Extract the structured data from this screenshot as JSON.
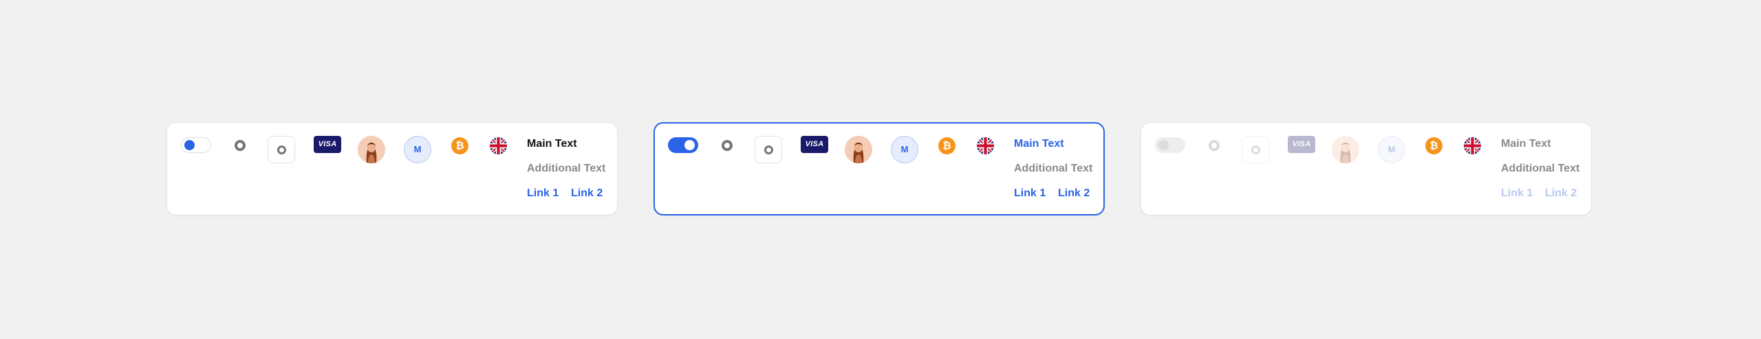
{
  "colors": {
    "accent": "#2a63e6",
    "background": "#f1f1f1",
    "card": "#ffffff",
    "bitcoin": "#f7931a",
    "visa": "#1a1a6b"
  },
  "cards": [
    {
      "state": "default",
      "toggle": "off",
      "visa_label": "VISA",
      "avatar_icon": "woman-avatar",
      "initial": "M",
      "btc_glyph": "₿",
      "flag_icon": "uk-flag-icon",
      "main_text": "Main Text",
      "additional_text": "Additional Text",
      "link_1": "Link 1",
      "link_2": "Link 2"
    },
    {
      "state": "active",
      "toggle": "on",
      "visa_label": "VISA",
      "avatar_icon": "woman-avatar",
      "initial": "M",
      "btc_glyph": "₿",
      "flag_icon": "uk-flag-icon",
      "main_text": "Main Text",
      "additional_text": "Additional Text",
      "link_1": "Link 1",
      "link_2": "Link 2"
    },
    {
      "state": "disabled",
      "toggle": "off",
      "visa_label": "VISA",
      "avatar_icon": "woman-avatar",
      "initial": "M",
      "btc_glyph": "₿",
      "flag_icon": "uk-flag-icon",
      "main_text": "Main Text",
      "additional_text": "Additional Text",
      "link_1": "Link 1",
      "link_2": "Link 2"
    }
  ]
}
